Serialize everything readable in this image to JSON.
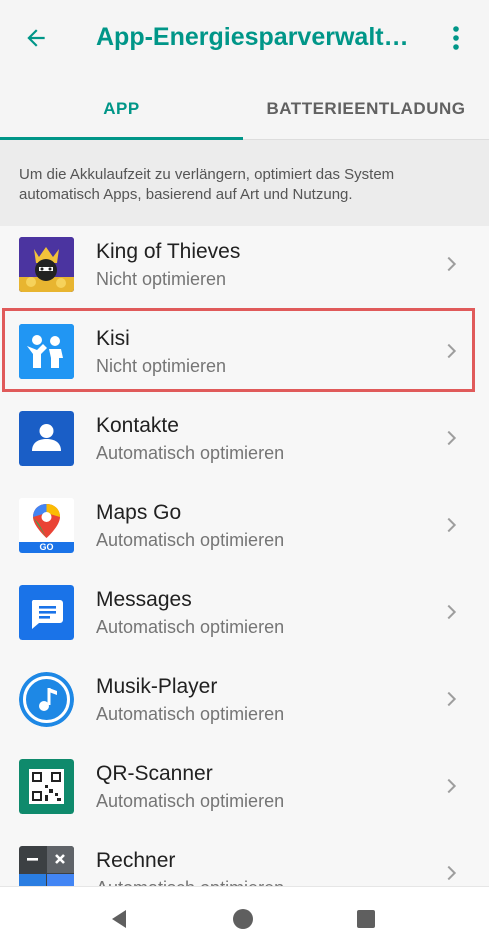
{
  "header": {
    "title": "App-Energiesparverwalt…",
    "back_icon": "arrow-back-icon",
    "menu_icon": "more-vert-icon"
  },
  "tabs": [
    {
      "label": "APP",
      "active": true
    },
    {
      "label": "BATTERIEENTLADUNG",
      "active": false
    }
  ],
  "description": "Um die Akkulaufzeit zu verlängern, optimiert das System automatisch Apps, basierend auf Art und Nutzung.",
  "apps": [
    {
      "name": "King of Thieves",
      "status": "Nicht optimieren",
      "icon": "king-of-thieves-icon"
    },
    {
      "name": "Kisi",
      "status": "Nicht optimieren",
      "icon": "kisi-icon"
    },
    {
      "name": "Kontakte",
      "status": "Automatisch optimieren",
      "icon": "contacts-icon"
    },
    {
      "name": "Maps Go",
      "status": "Automatisch optimieren",
      "icon": "maps-go-icon",
      "badge": "GO"
    },
    {
      "name": "Messages",
      "status": "Automatisch optimieren",
      "icon": "messages-icon"
    },
    {
      "name": "Musik-Player",
      "status": "Automatisch optimieren",
      "icon": "music-player-icon"
    },
    {
      "name": "QR-Scanner",
      "status": "Automatisch optimieren",
      "icon": "qr-scanner-icon"
    },
    {
      "name": "Rechner",
      "status": "Automatisch optimieren",
      "icon": "calculator-icon"
    }
  ],
  "colors": {
    "accent": "#009688",
    "highlight": "#e05a5a"
  },
  "nav": {
    "back_icon": "nav-back-icon",
    "home_icon": "nav-home-icon",
    "recents_icon": "nav-recents-icon"
  }
}
